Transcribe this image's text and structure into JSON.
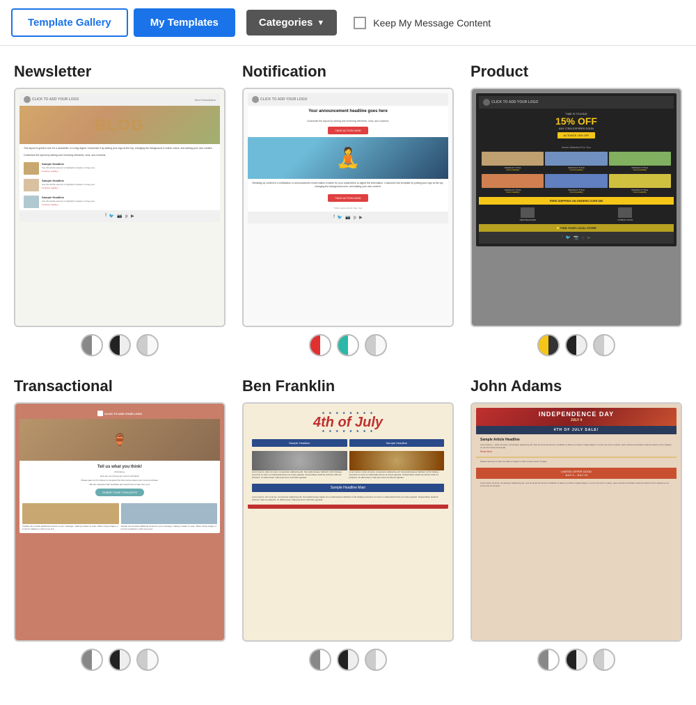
{
  "header": {
    "tab_gallery_label": "Template Gallery",
    "tab_my_templates_label": "My Templates",
    "categories_label": "Categories",
    "keep_message_label": "Keep My Message Content"
  },
  "templates": [
    {
      "id": "newsletter",
      "title": "Newsletter",
      "swatches": [
        "gray-half",
        "dark-half",
        "light-half"
      ]
    },
    {
      "id": "notification",
      "title": "Notification",
      "swatches": [
        "red-white",
        "teal",
        "light-half"
      ]
    },
    {
      "id": "product",
      "title": "Product",
      "swatches": [
        "yellow-dark",
        "dark-half",
        "light-half"
      ]
    },
    {
      "id": "transactional",
      "title": "Transactional",
      "swatches": [
        "gray-half",
        "dark-half",
        "light-half"
      ]
    },
    {
      "id": "benfranklin",
      "title": "Ben Franklin",
      "swatches": [
        "gray-half",
        "dark-half",
        "light-half"
      ]
    },
    {
      "id": "johnadams",
      "title": "John Adams",
      "swatches": [
        "gray-half",
        "dark-half",
        "light-half"
      ]
    }
  ]
}
